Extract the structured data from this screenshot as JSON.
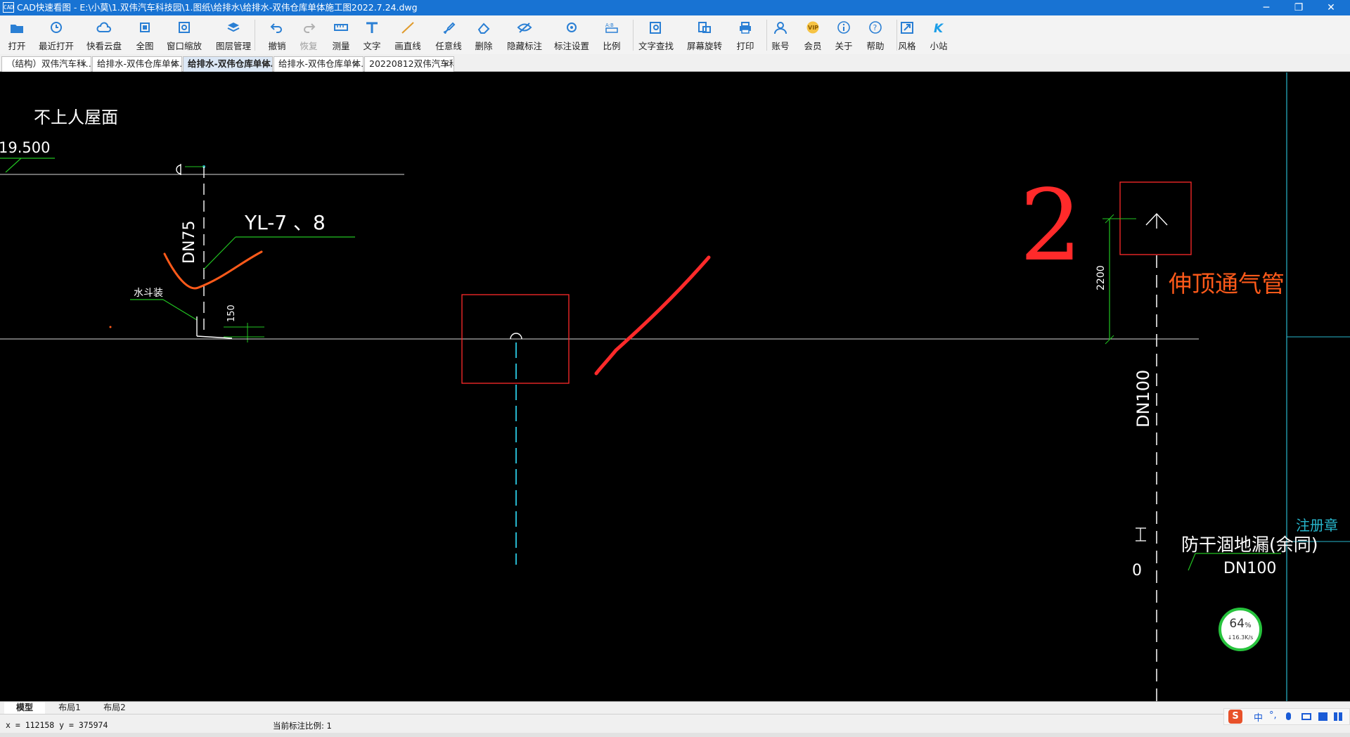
{
  "window": {
    "title": "CAD快速看图 - E:\\小莫\\1.双伟汽车科技园\\1.图纸\\给排水\\给排水-双伟仓库单体施工图2022.7.24.dwg",
    "app_icon": "CAD",
    "minimize": "─",
    "maximize": "❐",
    "close": "✕"
  },
  "toolbar": [
    {
      "id": "open",
      "label": "打开",
      "icon": "folder-open-icon"
    },
    {
      "id": "recent",
      "label": "最近打开",
      "icon": "clock-icon"
    },
    {
      "id": "cloud",
      "label": "快看云盘",
      "icon": "cloud-icon"
    },
    {
      "id": "fullview",
      "label": "全图",
      "icon": "fullview-icon"
    },
    {
      "id": "zoomwin",
      "label": "窗口缩放",
      "icon": "zoom-window-icon"
    },
    {
      "id": "layers",
      "label": "图层管理",
      "icon": "layers-icon"
    },
    {
      "id": "undo",
      "label": "撤销",
      "icon": "undo-icon"
    },
    {
      "id": "redo",
      "label": "恢复",
      "icon": "redo-icon",
      "disabled": true
    },
    {
      "id": "measure",
      "label": "测量",
      "icon": "ruler-icon"
    },
    {
      "id": "text",
      "label": "文字",
      "icon": "text-icon"
    },
    {
      "id": "line",
      "label": "画直线",
      "icon": "line-icon"
    },
    {
      "id": "freehand",
      "label": "任意线",
      "icon": "pen-icon"
    },
    {
      "id": "erase",
      "label": "删除",
      "icon": "eraser-icon"
    },
    {
      "id": "hide",
      "label": "隐藏标注",
      "icon": "eye-hide-icon"
    },
    {
      "id": "annoset",
      "label": "标注设置",
      "icon": "annotation-settings-icon"
    },
    {
      "id": "scale",
      "label": "比例",
      "icon": "scale-icon"
    },
    {
      "id": "findtext",
      "label": "文字查找",
      "icon": "text-search-icon"
    },
    {
      "id": "rotate",
      "label": "屏幕旋转",
      "icon": "rotate-screen-icon"
    },
    {
      "id": "print",
      "label": "打印",
      "icon": "printer-icon"
    },
    {
      "id": "account",
      "label": "账号",
      "icon": "user-icon"
    },
    {
      "id": "vip",
      "label": "会员",
      "icon": "vip-icon"
    },
    {
      "id": "about",
      "label": "关于",
      "icon": "info-icon"
    },
    {
      "id": "help",
      "label": "帮助",
      "icon": "help-icon"
    },
    {
      "id": "style",
      "label": "风格",
      "icon": "style-icon"
    },
    {
      "id": "site",
      "label": "小站",
      "icon": "k-site-icon"
    }
  ],
  "tabs": [
    {
      "label": "（结构）双伟汽车科…",
      "close": "✕",
      "active": false
    },
    {
      "label": "给排水-双伟仓库单体…",
      "close": "✕",
      "active": false
    },
    {
      "label": "给排水-双伟仓库单体…",
      "close": "✕",
      "active": true
    },
    {
      "label": "给排水-双伟仓库单体…",
      "close": "✕",
      "active": false
    },
    {
      "label": "20220812双伟汽车科…",
      "close": "✕",
      "active": false
    }
  ],
  "drawing": {
    "roof_label": "不上人屋面",
    "elevation": "19.500",
    "pipe_size": "DN75",
    "pipe_id": "YL-7 、8",
    "fixture_note": "水斗装",
    "dim_150": "150",
    "dim_2200": "2200",
    "main_pipe": "DN100",
    "vent_label": "伸顶通气管",
    "handwritten_2": "2",
    "floor_drain": "防干涸地漏(余同)",
    "floor_drain_size": "DN100",
    "stamp_label": "注册章"
  },
  "speed": {
    "percent": "64",
    "unit": "%",
    "rate": "↓16.3K/s"
  },
  "layout_tabs": [
    {
      "label": "模型",
      "active": true
    },
    {
      "label": "布局1",
      "active": false
    },
    {
      "label": "布局2",
      "active": false
    }
  ],
  "status": {
    "coords": "x = 112158  y = 375974",
    "scale": "当前标注比例: 1"
  },
  "ime": {
    "logo": "S",
    "lang": "中",
    "punct": "°,",
    "mic": "mic",
    "kbd": "kbd",
    "shirt": "shirt",
    "grid": "grid"
  },
  "colors": {
    "titlebar": "#1873d3",
    "canvas": "#000000",
    "markup_red": "#ff2a2a",
    "markup_orange": "#ff5a1a",
    "cad_green": "#22c322",
    "cad_cyan": "#27b6cc"
  }
}
